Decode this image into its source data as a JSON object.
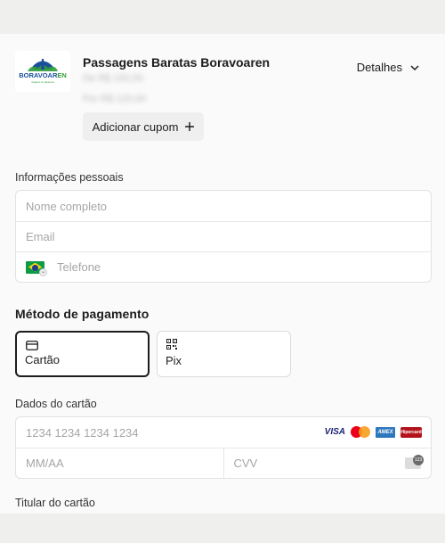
{
  "header": {
    "product_title": "Passagens Baratas Boravoaren",
    "price_original": "De R$ 150,00",
    "price_current": "Por R$ 120,00",
    "details_label": "Detalhes",
    "coupon_label": "Adicionar cupom"
  },
  "logo": {
    "word1": "BORAVOAR",
    "word2": "EN",
    "tagline": "viagens & passeios"
  },
  "personal": {
    "section_label": "Informações pessoais",
    "name_placeholder": "Nome completo",
    "email_placeholder": "Email",
    "phone_placeholder": "Telefone"
  },
  "payment": {
    "heading": "Método de pagamento",
    "options": [
      {
        "label": "Cartão",
        "selected": true
      },
      {
        "label": "Pix",
        "selected": false
      }
    ]
  },
  "card_data": {
    "section_label": "Dados do cartão",
    "number_placeholder": "1234 1234 1234 1234",
    "expiry_placeholder": "MM/AA",
    "cvv_placeholder": "CVV",
    "brands": [
      "VISA",
      "Mastercard",
      "AMEX",
      "Hipercard"
    ]
  },
  "holder": {
    "section_label": "Titular do cartão"
  },
  "colors": {
    "accent": "#1d1d1d",
    "logo_blue": "#1b4f9c",
    "logo_green": "#2f9d3a"
  }
}
